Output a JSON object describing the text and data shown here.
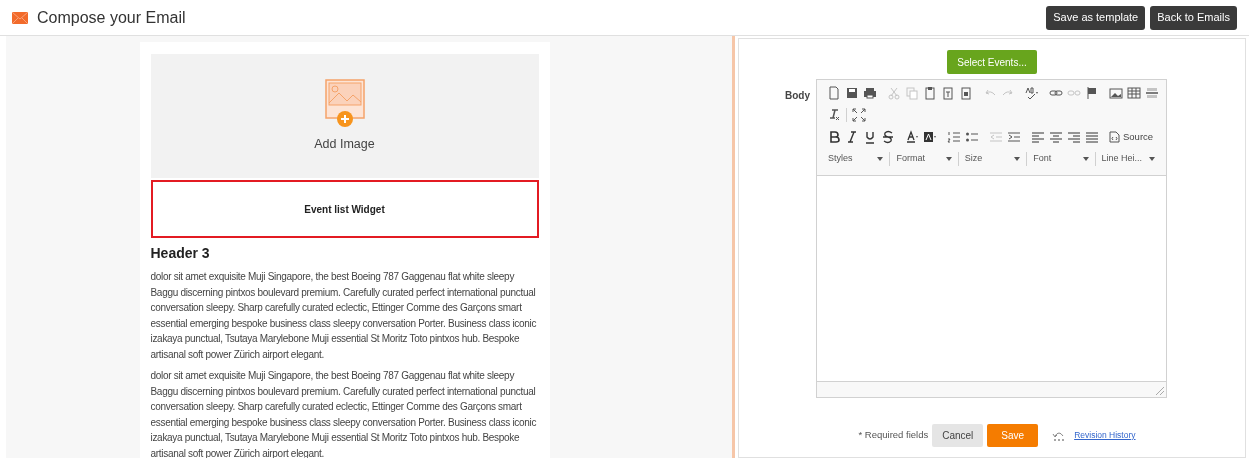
{
  "header": {
    "title": "Compose your Email",
    "buttons": [
      "Save as template",
      "Back to Emails"
    ]
  },
  "preview": {
    "image_placeholder": "Add Image",
    "widget": "Event list Widget",
    "heading": "Header 3",
    "paragraphs": [
      "dolor sit amet exquisite Muji Singapore, the best Boeing 787 Gaggenau flat white sleepy Baggu discerning pintxos boulevard premium. Carefully curated perfect international punctual conversation sleepy. Sharp carefully curated eclectic, Ettinger Comme des Garçons smart essential emerging bespoke business class sleepy conversation Porter. Business class iconic izakaya punctual, Tsutaya Marylebone Muji essential St Moritz Toto pintxos hub. Bespoke artisanal soft power Zürich airport elegant.",
      "dolor sit amet exquisite Muji Singapore, the best Boeing 787 Gaggenau flat white sleepy Baggu discerning pintxos boulevard premium. Carefully curated perfect international punctual conversation sleepy. Sharp carefully curated eclectic, Ettinger Comme des Garçons smart essential emerging bespoke business class sleepy conversation Porter. Business class iconic izakaya punctual, Tsutaya Marylebone Muji essential St Moritz Toto pintxos hub. Bespoke artisanal soft power Zürich airport elegant."
    ]
  },
  "editor": {
    "select_button": "Select Events...",
    "body_label": "Body",
    "source_button": "Source",
    "dropdowns": [
      "Styles",
      "Format",
      "Size",
      "Font",
      "Line Hei..."
    ]
  },
  "footer": {
    "required_note": "* Required fields",
    "cancel": "Cancel",
    "save": "Save",
    "history_link": "Revision History"
  }
}
